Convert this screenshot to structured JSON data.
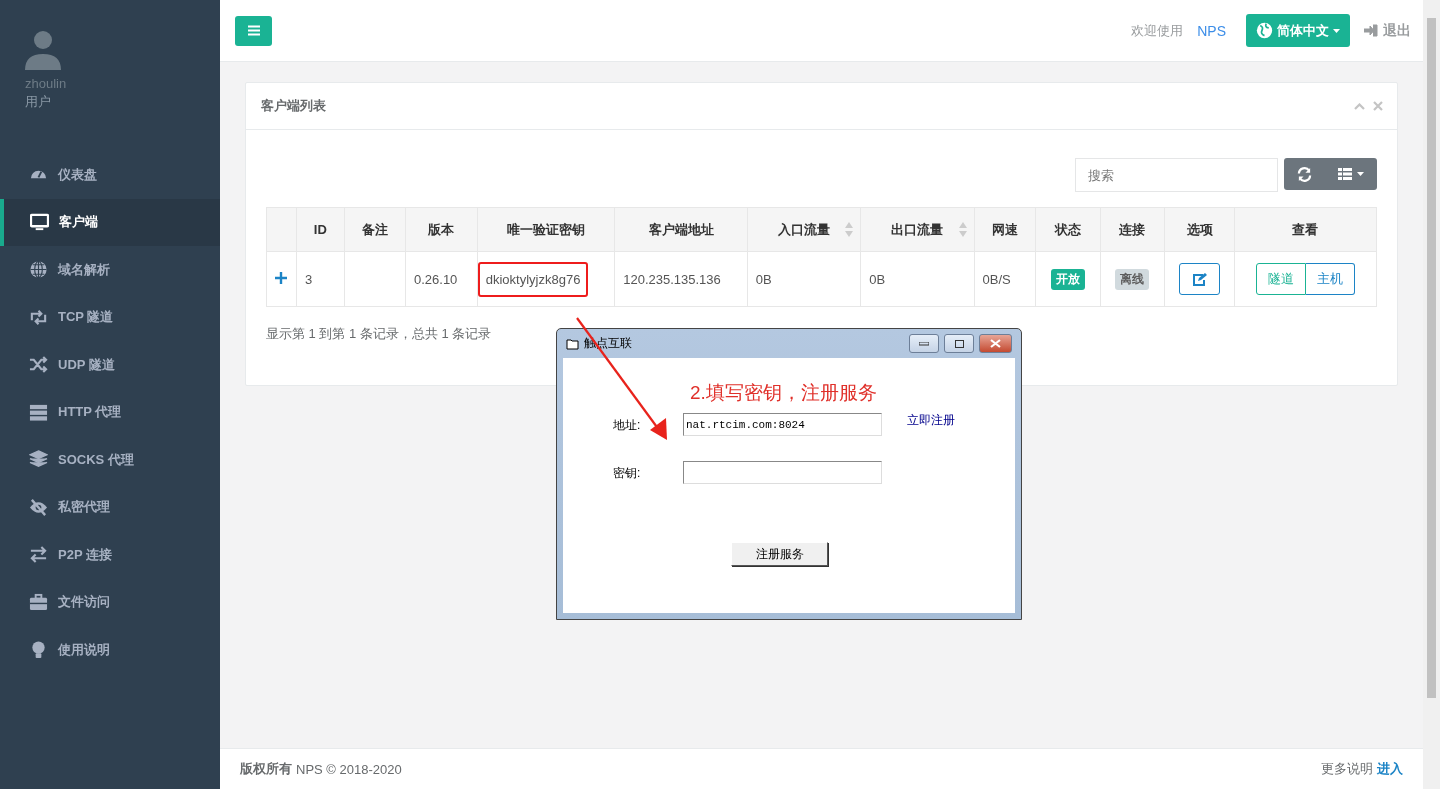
{
  "sidebar": {
    "user": {
      "name": "zhoulin",
      "role": "用户"
    },
    "items": [
      {
        "label": "仪表盘",
        "selected": false
      },
      {
        "label": "客户端",
        "selected": true
      },
      {
        "label": "域名解析",
        "selected": false
      },
      {
        "label": "TCP 隧道",
        "selected": false
      },
      {
        "label": "UDP 隧道",
        "selected": false
      },
      {
        "label": "HTTP 代理",
        "selected": false
      },
      {
        "label": "SOCKS 代理",
        "selected": false
      },
      {
        "label": "私密代理",
        "selected": false
      },
      {
        "label": "P2P 连接",
        "selected": false
      },
      {
        "label": "文件访问",
        "selected": false
      },
      {
        "label": "使用说明",
        "selected": false
      }
    ]
  },
  "topbar": {
    "welcome": "欢迎使用",
    "brand": "NPS",
    "language": "简体中文",
    "logout": "退出"
  },
  "panel": {
    "title": "客户端列表",
    "search": {
      "placeholder": "搜索"
    },
    "table": {
      "columns": [
        {
          "label": "ID",
          "sortable": false
        },
        {
          "label": "备注",
          "sortable": false
        },
        {
          "label": "版本",
          "sortable": false
        },
        {
          "label": "唯一验证密钥",
          "sortable": false
        },
        {
          "label": "客户端地址",
          "sortable": false
        },
        {
          "label": "入口流量",
          "sortable": true
        },
        {
          "label": "出口流量",
          "sortable": true
        },
        {
          "label": "网速",
          "sortable": false
        },
        {
          "label": "状态",
          "sortable": false
        },
        {
          "label": "连接",
          "sortable": false
        },
        {
          "label": "选项",
          "sortable": false
        },
        {
          "label": "查看",
          "sortable": false
        }
      ],
      "rows": [
        {
          "expanded": false,
          "id": "3",
          "version": "0.26.10",
          "key": "dkioktylyjzk8g76",
          "key_highlighted": true,
          "address": "120.235.135.136",
          "in_traffic": "0B",
          "out_traffic": "0B",
          "speed": "0B/S",
          "status": {
            "label": "开放",
            "on": true
          },
          "connection": {
            "label": "离线",
            "on": false
          },
          "view_buttons": [
            "隧道",
            "主机"
          ]
        }
      ]
    },
    "pagination_info": "显示第 1 到第 1 条记录，总共 1 条记录"
  },
  "dialog": {
    "title": "触点互联",
    "heading": "2.填写密钥，注册服务",
    "fields": [
      {
        "label": "地址:",
        "value": "nat.rtcim.com:8024"
      },
      {
        "label": "密钥:"
      }
    ],
    "register_link": "立即注册",
    "button": "注册服务"
  },
  "footer": {
    "copyright_label": "版权所有",
    "copyright_text": "NPS © 2018-2020",
    "more": "更多说明",
    "link": "进入"
  }
}
